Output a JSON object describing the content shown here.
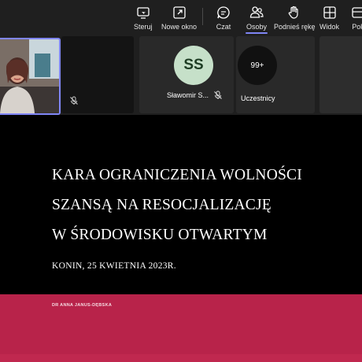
{
  "toolbar": {
    "items": [
      {
        "label": "Steruj",
        "icon": "steer-icon"
      },
      {
        "label": "Nowe okno",
        "icon": "new-window-icon"
      },
      {
        "label": "Czat",
        "icon": "chat-icon"
      },
      {
        "label": "Osoby",
        "icon": "people-icon",
        "active": true
      },
      {
        "label": "Podnieś rękę",
        "icon": "raise-hand-icon"
      },
      {
        "label": "Widok",
        "icon": "view-grid-icon"
      },
      {
        "label": "Pok",
        "icon": "rooms-icon"
      }
    ],
    "accent_color": "#7f85f5"
  },
  "participants": {
    "tile1": {
      "type": "video",
      "muted": true
    },
    "tile2": {
      "initials": "SS",
      "name": "Sławomir S...",
      "muted": true,
      "avatar_color": "#c6e0c9"
    },
    "tile3": {
      "count": "99+",
      "label": "Uczestnicy"
    }
  },
  "slide": {
    "title_lines": [
      "KARA OGRANICZENIA WOLNOŚCI",
      "SZANSĄ NA RESOCJALIZACJĘ",
      "W ŚRODOWISKU OTWARTYM"
    ],
    "subtitle": "KONIN, 25 KWIETNIA 2023R.",
    "author": "DR ANNA JANUS-DĘBSKA",
    "band_color": "#b8234a"
  }
}
